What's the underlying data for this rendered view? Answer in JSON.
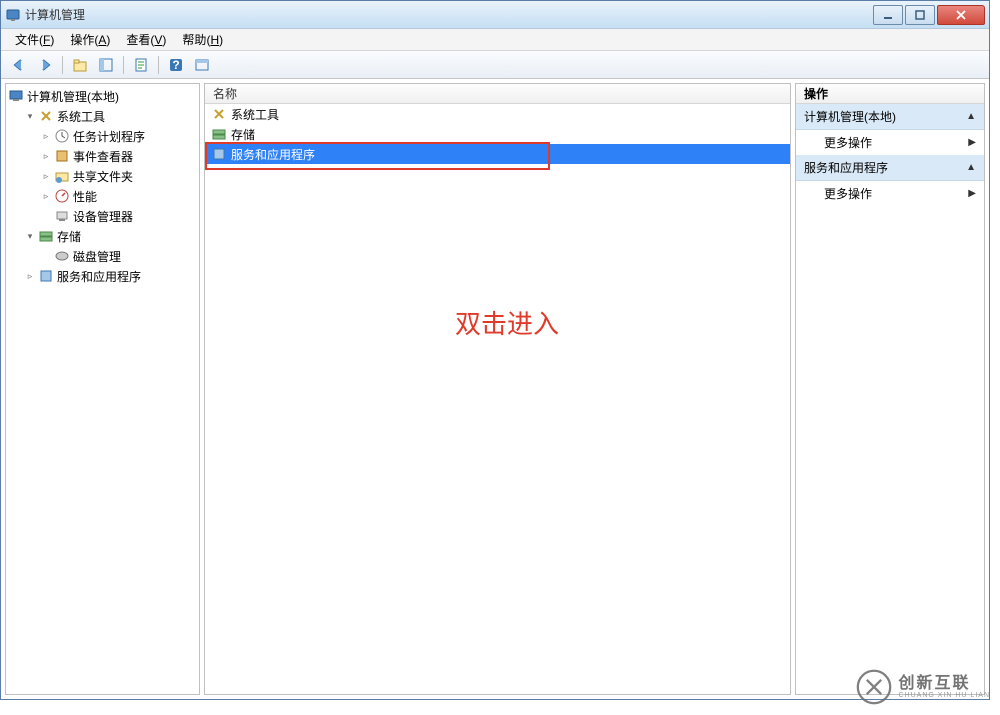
{
  "window": {
    "title": "计算机管理"
  },
  "menu": {
    "file": "文件",
    "file_key": "F",
    "action": "操作",
    "action_key": "A",
    "view": "查看",
    "view_key": "V",
    "help": "帮助",
    "help_key": "H"
  },
  "tree": {
    "root": "计算机管理(本地)",
    "system_tools": "系统工具",
    "task_scheduler": "任务计划程序",
    "event_viewer": "事件查看器",
    "shared_folders": "共享文件夹",
    "performance": "性能",
    "device_manager": "设备管理器",
    "storage": "存储",
    "disk_management": "磁盘管理",
    "services_apps": "服务和应用程序"
  },
  "mid": {
    "col_name": "名称",
    "items": [
      "系统工具",
      "存储",
      "服务和应用程序"
    ]
  },
  "annotation": "双击进入",
  "right": {
    "header": "操作",
    "section1": "计算机管理(本地)",
    "more_actions": "更多操作",
    "section2": "服务和应用程序"
  },
  "watermark": {
    "cn": "创新互联",
    "en": "CHUANG XIN HU LIAN"
  }
}
